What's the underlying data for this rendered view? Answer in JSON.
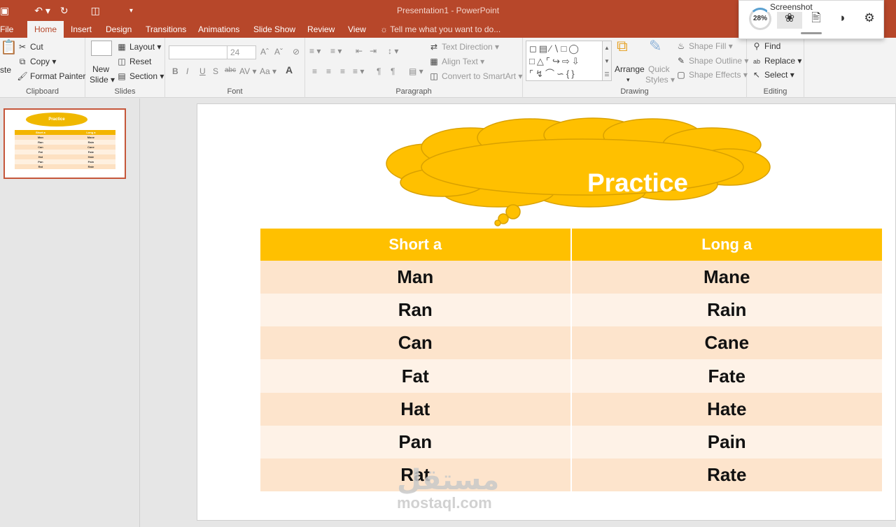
{
  "window": {
    "title": "Presentation1 - PowerPoint"
  },
  "qat": {
    "save_icon": "save-icon",
    "undo_icon": "undo-icon",
    "redo_icon": "redo-icon",
    "present_icon": "present-icon",
    "customize_icon": "customize-icon"
  },
  "tabs": [
    {
      "label": "File"
    },
    {
      "label": "Home"
    },
    {
      "label": "Insert"
    },
    {
      "label": "Design"
    },
    {
      "label": "Transitions"
    },
    {
      "label": "Animations"
    },
    {
      "label": "Slide Show"
    },
    {
      "label": "Review"
    },
    {
      "label": "View"
    }
  ],
  "tell_me": "Tell me what you want to do...",
  "ribbon": {
    "clipboard": {
      "label": "Clipboard",
      "paste": "ste",
      "cut": "Cut",
      "copy": "Copy",
      "format_painter": "Format Painter"
    },
    "slides": {
      "label": "Slides",
      "new_slide_1": "New",
      "new_slide_2": "Slide",
      "layout": "Layout",
      "reset": "Reset",
      "section": "Section"
    },
    "font": {
      "label": "Font",
      "size": "24"
    },
    "paragraph": {
      "label": "Paragraph",
      "text_direction": "Text Direction",
      "align_text": "Align Text",
      "convert_smartart": "Convert to SmartArt"
    },
    "drawing": {
      "label": "Drawing",
      "arrange": "Arrange",
      "quick_styles_1": "Quick",
      "quick_styles_2": "Styles",
      "shape_fill": "Shape Fill",
      "shape_outline": "Shape Outline",
      "shape_effects": "Shape Effects"
    },
    "editing": {
      "label": "Editing",
      "find": "Find",
      "replace": "Replace",
      "select": "Select"
    }
  },
  "capture_bar": {
    "zoom": "28%",
    "tooltip": "Screenshot"
  },
  "slide": {
    "title": "Practice",
    "table": {
      "headers": [
        "Short a",
        "Long a"
      ],
      "rows": [
        [
          "Man",
          "Mane"
        ],
        [
          "Ran",
          "Rain"
        ],
        [
          "Can",
          "Cane"
        ],
        [
          "Fat",
          "Fate"
        ],
        [
          "Hat",
          "Hate"
        ],
        [
          "Pan",
          "Pain"
        ],
        [
          "Rat",
          "Rate"
        ]
      ]
    }
  },
  "watermark": {
    "arabic": "مستقل",
    "latin": "mostaql.com"
  },
  "colors": {
    "accent": "#b7472a",
    "cloud": "#ffc000",
    "row_dark": "#fde4cc",
    "row_light": "#fef2e7"
  }
}
